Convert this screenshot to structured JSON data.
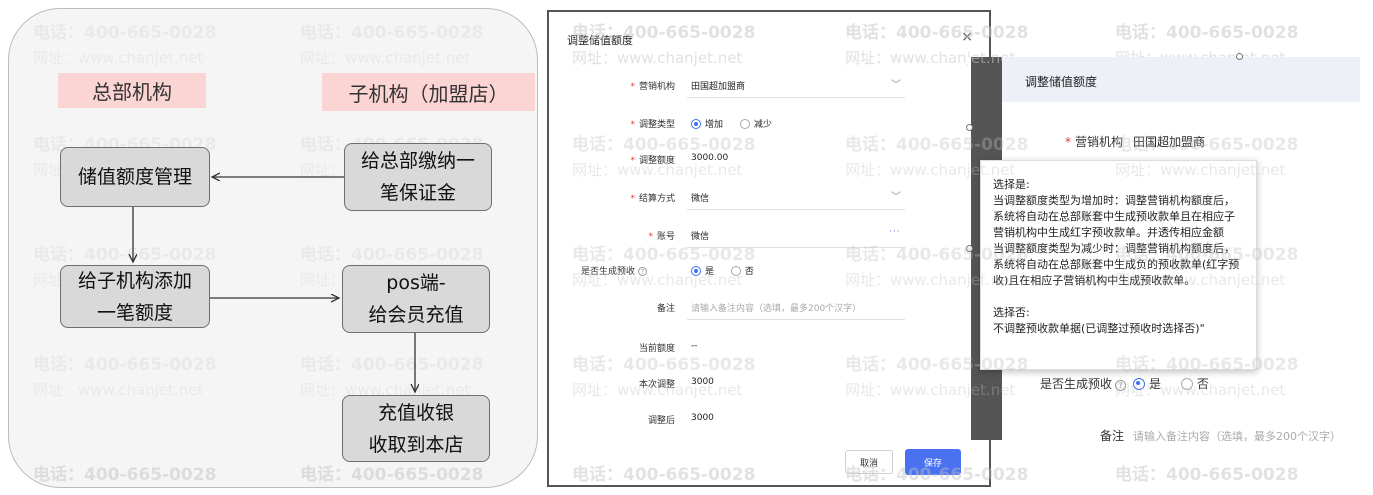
{
  "watermark": {
    "phone": "电话：400-665-0028",
    "site": "网址：www.chanjet.net"
  },
  "flowchart": {
    "header_left": "总部机构",
    "header_right": "子机构（加盟店）",
    "node_storage_quota": "储值额度管理",
    "node_pay_deposit": [
      "给总部缴纳一",
      "笔保证金"
    ],
    "node_add_quota": [
      "给子机构添加",
      "一笔额度"
    ],
    "node_pos": [
      "pos端-",
      "给会员充值"
    ],
    "node_cashier": [
      "充值收银",
      "收取到本店"
    ]
  },
  "dialog": {
    "title": "调整储值额度",
    "close_label": "×",
    "fields": {
      "marketing_org": {
        "label": "营销机构",
        "value": "田国超加盟商"
      },
      "adjust_type": {
        "label": "调整类型",
        "option_increase": "增加",
        "option_decrease": "减少",
        "selected": "增加"
      },
      "adjust_amount": {
        "label": "调整额度",
        "value": "3000.00"
      },
      "settlement": {
        "label": "结算方式",
        "value": "微信"
      },
      "account": {
        "label": "账号",
        "value": "微信",
        "more": "···"
      },
      "gen_receipt": {
        "label": "是否生成预收",
        "help": "?",
        "option_yes": "是",
        "option_no": "否",
        "selected": "是"
      },
      "remark": {
        "label": "备注",
        "placeholder": "请输入备注内容（选填，最多200个汉字）"
      },
      "current_quota": {
        "label": "当前额度",
        "value": "--"
      },
      "this_adjust": {
        "label": "本次调整",
        "value": "3000"
      },
      "after_adjust": {
        "label": "调整后",
        "value": "3000"
      }
    },
    "cancel_label": "取消",
    "save_label": "保存"
  },
  "zoom": {
    "title": "调整储值额度",
    "marketing_org_label": "营销机构",
    "marketing_org_value": "田国超加盟商",
    "gen_receipt_label": "是否生成预收",
    "help": "?",
    "option_yes": "是",
    "option_no": "否",
    "remark_label": "备注",
    "remark_placeholder": "请输入备注内容（选填，最多200个汉字）",
    "tooltip": {
      "yes_title": "选择是:",
      "yes_body": "当调整额度类型为增加时：调整营销机构额度后，\n系统将自动在总部账套中生成预收款单且在相应子\n营销机构中生成红字预收款单。并透传相应金额\n当调整额度类型为减少时：调整营销机构额度后，\n系统将自动在总部账套中生成负的预收款单(红字预\n收)且在相应子营销机构中生成预收款单。",
      "no_title": "选择否:",
      "no_body": "不调整预收款单据(已调整过预收时选择否)\""
    }
  },
  "colors": {
    "header_pink": "#fbd4d4",
    "node_gray": "#d9d9d9",
    "primary_blue": "#4a72f0",
    "required_red": "#e23b3b"
  }
}
